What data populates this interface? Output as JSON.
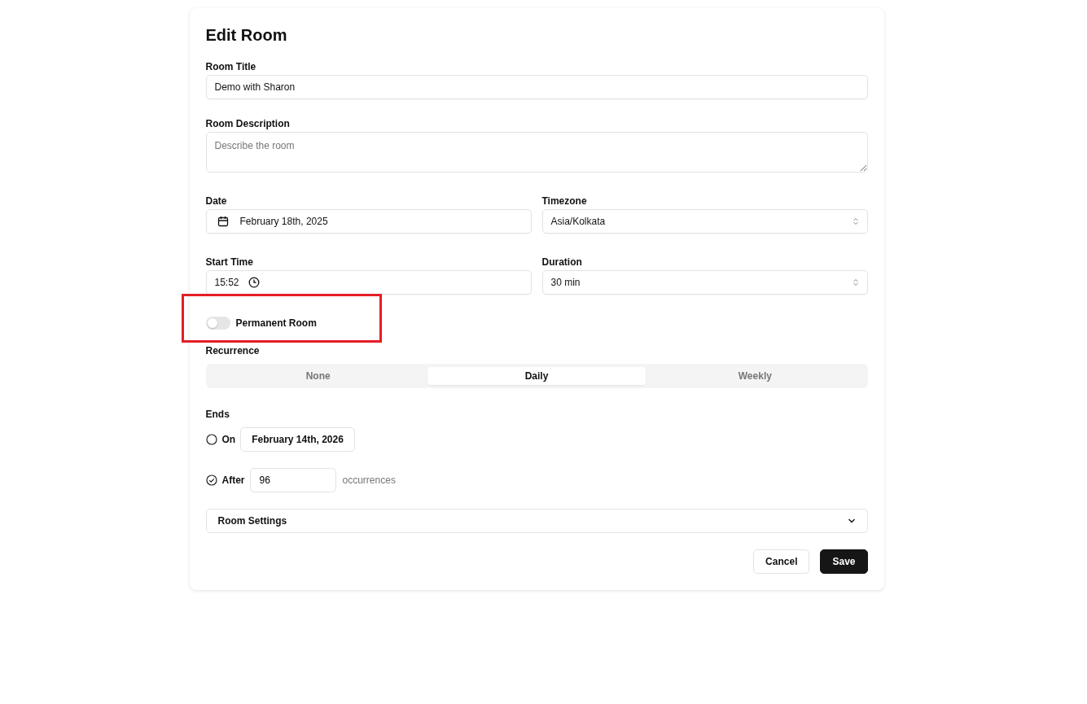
{
  "title": "Edit Room",
  "room_title": {
    "label": "Room Title",
    "value": "Demo with Sharon"
  },
  "room_description": {
    "label": "Room Description",
    "placeholder": "Describe the room"
  },
  "date": {
    "label": "Date",
    "value": "February 18th, 2025"
  },
  "timezone": {
    "label": "Timezone",
    "value": "Asia/Kolkata"
  },
  "start_time": {
    "label": "Start Time",
    "value": "15:52"
  },
  "duration": {
    "label": "Duration",
    "value": "30 min"
  },
  "permanent_room": {
    "label": "Permanent Room",
    "on": false,
    "highlighted": true
  },
  "recurrence": {
    "label": "Recurrence",
    "options": [
      {
        "label": "None",
        "selected": false
      },
      {
        "label": "Daily",
        "selected": true
      },
      {
        "label": "Weekly",
        "selected": false
      }
    ]
  },
  "ends": {
    "label": "Ends",
    "options": [
      {
        "kind": "date",
        "label": "On",
        "selected": false,
        "value": "February 14th, 2026"
      },
      {
        "kind": "count",
        "label": "After",
        "selected": true,
        "value": "96",
        "suffix": "occurrences"
      }
    ]
  },
  "room_settings": {
    "label": "Room Settings",
    "expanded": false
  },
  "buttons": [
    {
      "kind": "secondary",
      "label": "Cancel"
    },
    {
      "kind": "primary",
      "label": "Save"
    }
  ]
}
